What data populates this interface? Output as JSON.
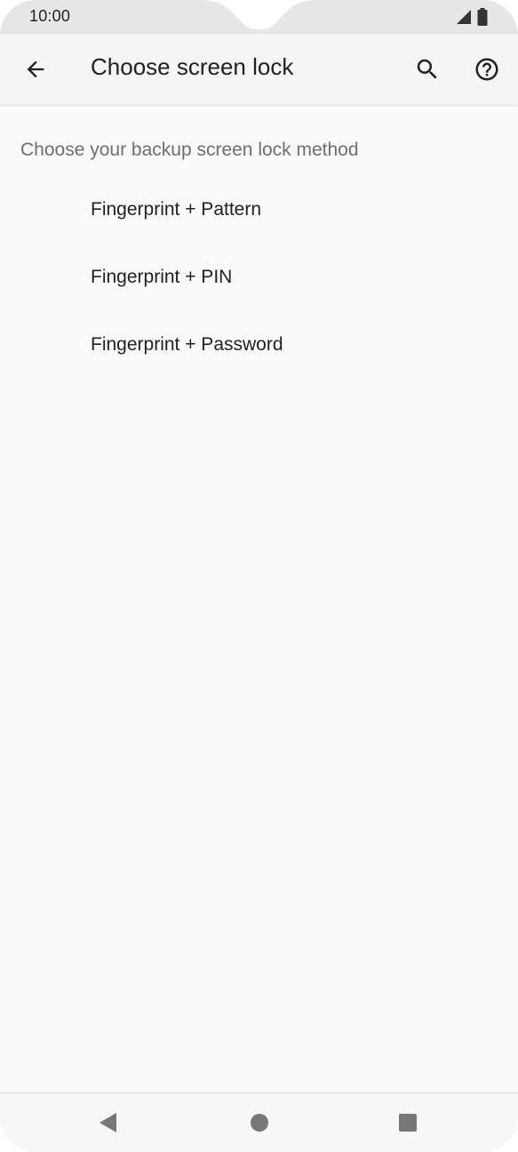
{
  "status_bar": {
    "time": "10:00",
    "icons": [
      "signal-icon",
      "battery-icon"
    ]
  },
  "app_bar": {
    "title": "Choose screen lock",
    "back_icon": "arrow-back-icon",
    "search_icon": "search-icon",
    "help_icon": "help-icon"
  },
  "content": {
    "subtitle": "Choose your backup screen lock method",
    "options": [
      {
        "label": "Fingerprint + Pattern"
      },
      {
        "label": "Fingerprint + PIN"
      },
      {
        "label": "Fingerprint + Password"
      }
    ]
  },
  "nav_bar": {
    "buttons": [
      "back-triangle-icon",
      "home-circle-icon",
      "recents-square-icon"
    ]
  },
  "colors": {
    "background": "#fafafa",
    "status_bar": "#e6e6e6",
    "app_bar": "#f5f5f5",
    "text_primary": "#202124",
    "text_secondary": "#6e6e6e",
    "nav_icon": "#777777"
  }
}
